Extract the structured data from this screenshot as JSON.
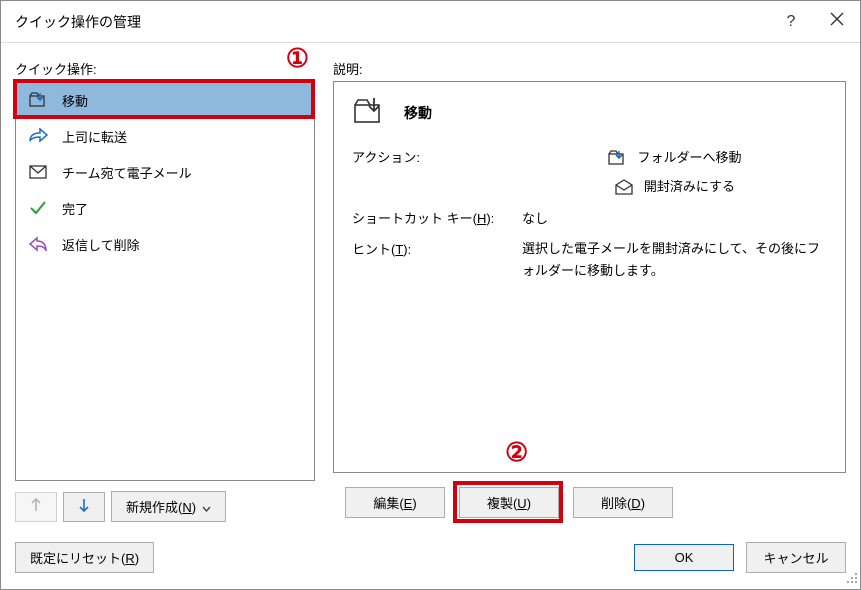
{
  "title": "クイック操作の管理",
  "left": {
    "label": "クイック操作:",
    "items": [
      {
        "icon": "move-folder",
        "label": "移動",
        "selected": true
      },
      {
        "icon": "forward",
        "label": "上司に転送"
      },
      {
        "icon": "envelope",
        "label": "チーム宛て電子メール"
      },
      {
        "icon": "check",
        "label": "完了"
      },
      {
        "icon": "reply-delete",
        "label": "返信して削除"
      }
    ],
    "new_button": "新規作成(N)"
  },
  "right": {
    "label": "説明:",
    "title_icon": "move-folder-large",
    "title": "移動",
    "action_label": "アクション:",
    "actions": [
      {
        "icon": "move-folder",
        "text": "フォルダーへ移動"
      },
      {
        "icon": "mark-read",
        "text": "開封済みにする"
      }
    ],
    "shortcut_label": "ショートカット キー(H):",
    "shortcut_value": "なし",
    "hint_label": "ヒント(T):",
    "hint_value": "選択した電子メールを開封済みにして、その後にフォルダーに移動します。",
    "edit_button": "編集(E)",
    "dup_button": "複製(U)",
    "del_button": "削除(D)"
  },
  "footer": {
    "reset": "既定にリセット(R)",
    "ok": "OK",
    "cancel": "キャンセル"
  },
  "annot": {
    "one": "①",
    "two": "②"
  }
}
